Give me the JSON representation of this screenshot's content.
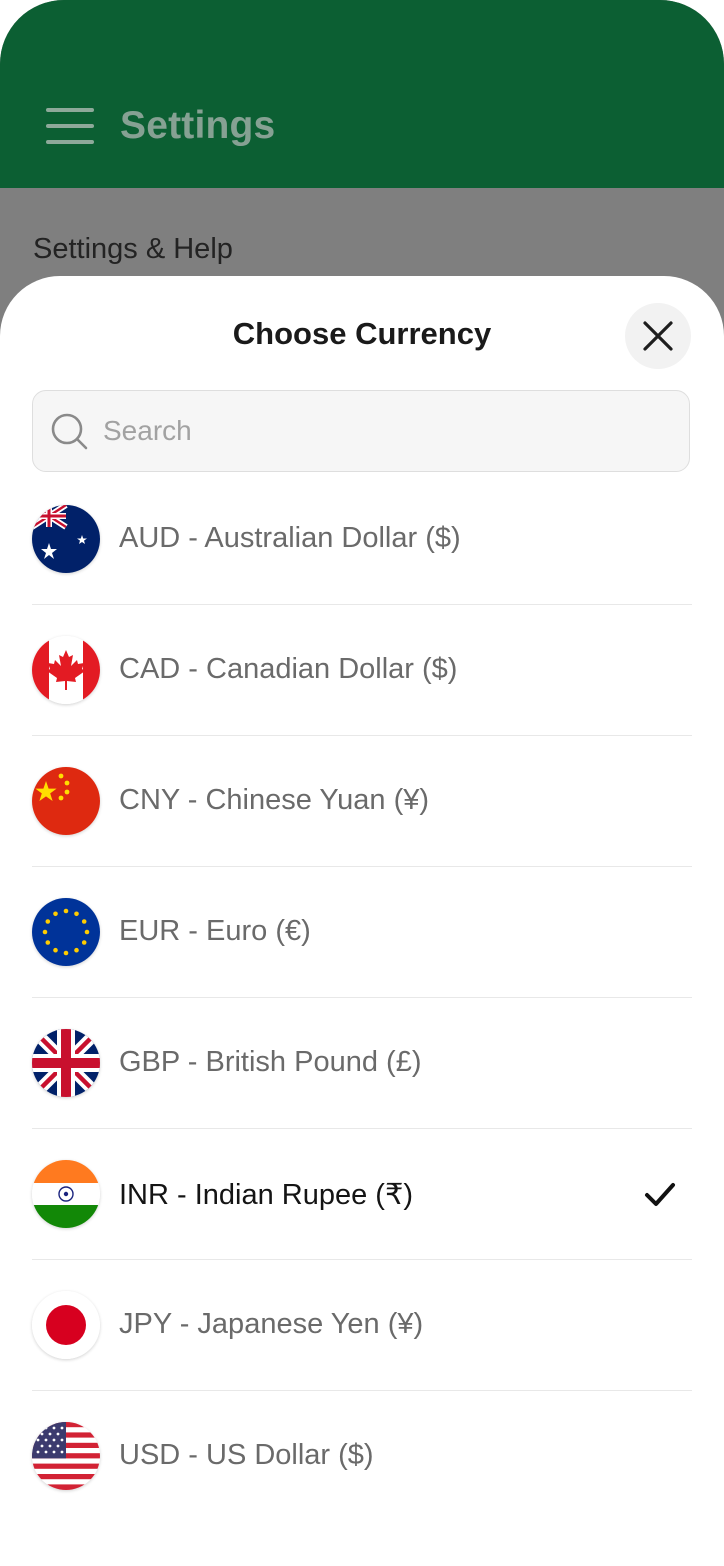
{
  "header": {
    "title": "Settings",
    "menu_icon": "hamburger-menu-icon"
  },
  "background": {
    "section_label": "Settings & Help"
  },
  "sheet": {
    "title": "Choose Currency",
    "close_icon": "close-icon",
    "search": {
      "placeholder": "Search",
      "value": ""
    },
    "currencies": [
      {
        "label": "AUD - Australian Dollar ($)",
        "flag": "australia-flag-icon",
        "selected": false
      },
      {
        "label": "CAD - Canadian Dollar ($)",
        "flag": "canada-flag-icon",
        "selected": false
      },
      {
        "label": "CNY - Chinese Yuan (¥)",
        "flag": "china-flag-icon",
        "selected": false
      },
      {
        "label": "EUR - Euro (€)",
        "flag": "eu-flag-icon",
        "selected": false
      },
      {
        "label": "GBP - British Pound (£)",
        "flag": "uk-flag-icon",
        "selected": false
      },
      {
        "label": "INR - Indian Rupee (₹)",
        "flag": "india-flag-icon",
        "selected": true
      },
      {
        "label": "JPY - Japanese Yen (¥)",
        "flag": "japan-flag-icon",
        "selected": false
      },
      {
        "label": "USD - US Dollar ($)",
        "flag": "us-flag-icon",
        "selected": false
      }
    ]
  },
  "colors": {
    "appbar": "#0c5f33",
    "overlay": "#7f7f7f",
    "sheet": "#ffffff",
    "check": "#111111"
  }
}
